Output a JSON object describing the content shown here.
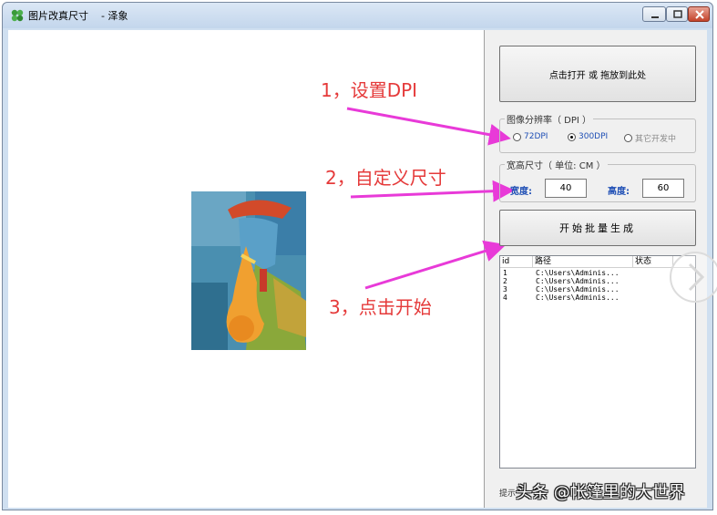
{
  "window": {
    "title": "图片改真尺寸    - 泽象"
  },
  "annotations": {
    "step1": "1，设置DPI",
    "step2": "2，自定义尺寸",
    "step3": "3，点击开始"
  },
  "panel": {
    "open_button": "点击打开 或 拖放到此处",
    "dpi_group_label": "图像分辨率（ DPI ）",
    "dpi_options": [
      {
        "label": "72DPI",
        "selected": false
      },
      {
        "label": "300DPI",
        "selected": true
      },
      {
        "label": "其它开发中",
        "selected": false
      }
    ],
    "size_group_label": "宽高尺寸（ 单位: CM ）",
    "width_label": "宽度:",
    "width_value": "40",
    "height_label": "高度:",
    "height_value": "60",
    "start_button": "开始批量生成",
    "list_columns": [
      "id",
      "路径",
      "状态"
    ],
    "list_rows": [
      {
        "id": "1",
        "path": "C:\\Users\\Adminis..."
      },
      {
        "id": "2",
        "path": "C:\\Users\\Adminis..."
      },
      {
        "id": "3",
        "path": "C:\\Users\\Adminis..."
      },
      {
        "id": "4",
        "path": "C:\\Users\\Adminis..."
      }
    ],
    "hint": "提示"
  },
  "watermark": "头条 @帐篷里的大世界",
  "colors": {
    "annotation": "#e53a3a",
    "arrow": "#e83ad8",
    "accent_blue": "#1f4fb5"
  }
}
